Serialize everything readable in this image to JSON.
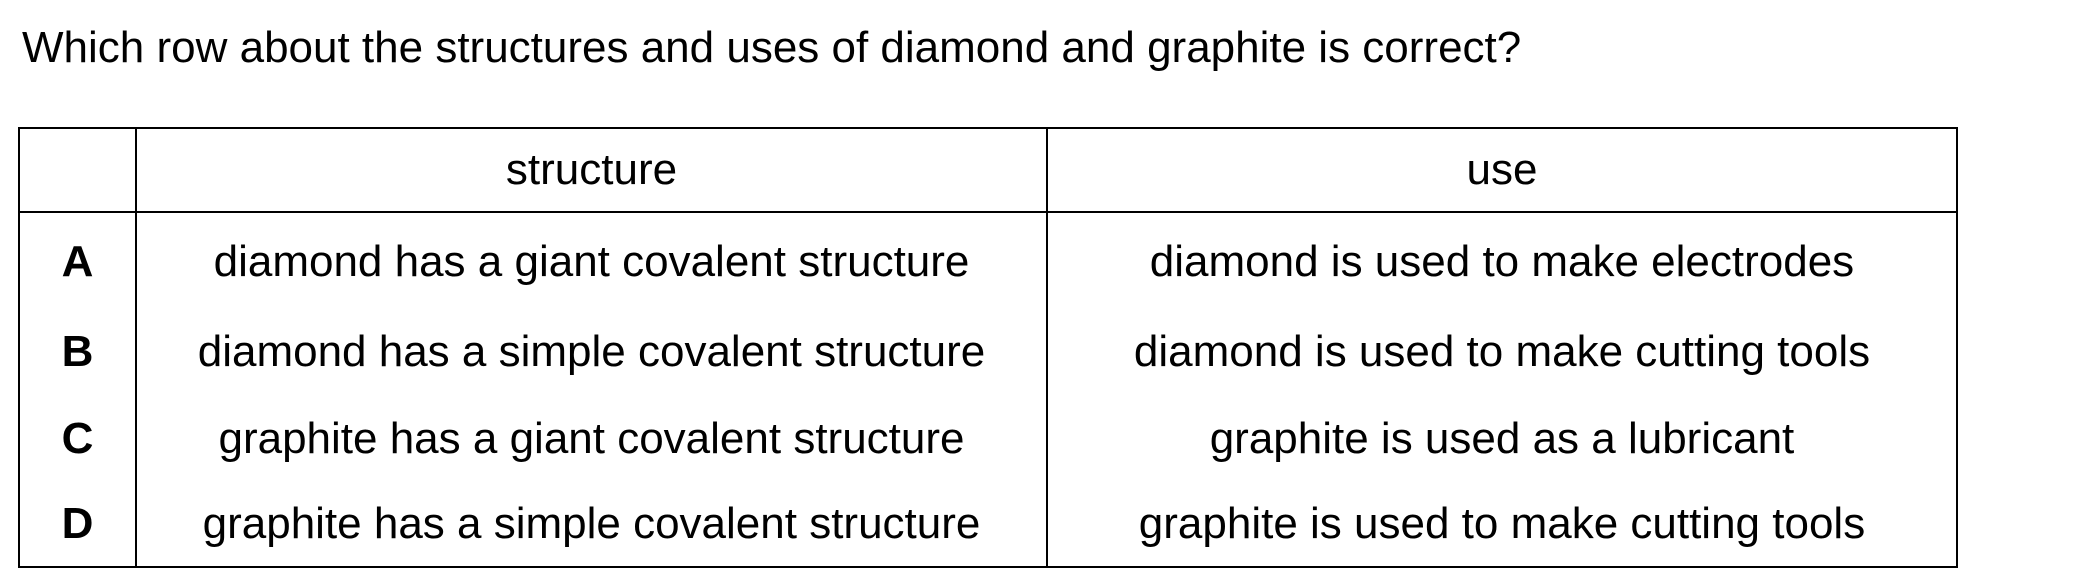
{
  "question": "Which row about the structures and uses of diamond and graphite is correct?",
  "table": {
    "headers": {
      "letter": "",
      "structure": "structure",
      "use": "use"
    },
    "rows": [
      {
        "letter": "A",
        "structure": "diamond has a giant covalent structure",
        "use": "diamond is used to make electrodes"
      },
      {
        "letter": "B",
        "structure": "diamond has a simple covalent structure",
        "use": "diamond is used to make cutting tools"
      },
      {
        "letter": "C",
        "structure": "graphite has a giant covalent structure",
        "use": "graphite is used as a lubricant"
      },
      {
        "letter": "D",
        "structure": "graphite has a simple covalent structure",
        "use": "graphite is used to make cutting tools"
      }
    ]
  }
}
